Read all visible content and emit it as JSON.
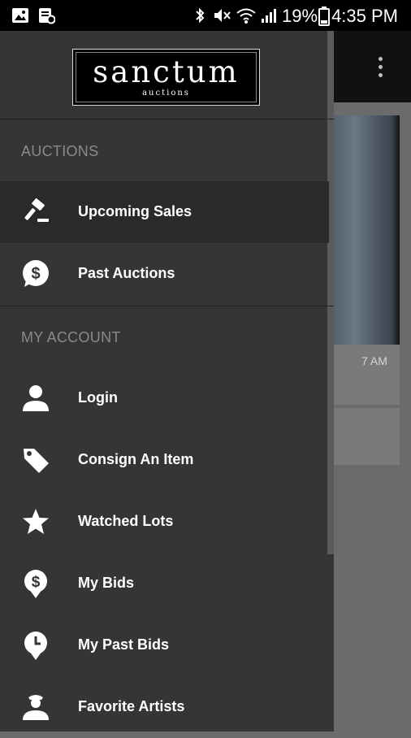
{
  "status_bar": {
    "battery_percent": "19%",
    "time": "4:35 PM"
  },
  "background": {
    "time_fragment": "7 AM"
  },
  "logo": {
    "main_text": "sanctum",
    "sub_text": "auctions"
  },
  "sections": {
    "auctions_label": "AUCTIONS",
    "account_label": "MY ACCOUNT"
  },
  "menu": {
    "upcoming_sales": "Upcoming Sales",
    "past_auctions": "Past Auctions",
    "login": "Login",
    "consign_item": "Consign An Item",
    "watched_lots": "Watched Lots",
    "my_bids": "My Bids",
    "my_past_bids": "My Past Bids",
    "favorite_artists": "Favorite Artists"
  },
  "icons": {
    "upcoming_sales": "gavel-icon",
    "past_auctions": "dollar-bubble-icon",
    "login": "person-icon",
    "consign_item": "tag-icon",
    "watched_lots": "star-icon",
    "my_bids": "dollar-pin-icon",
    "my_past_bids": "clock-pin-icon",
    "favorite_artists": "artist-icon"
  },
  "colors": {
    "drawer_bg": "#353535",
    "active_item_bg": "#2a2a2a",
    "section_label": "#8a8a8a",
    "status_bar": "#000000"
  }
}
